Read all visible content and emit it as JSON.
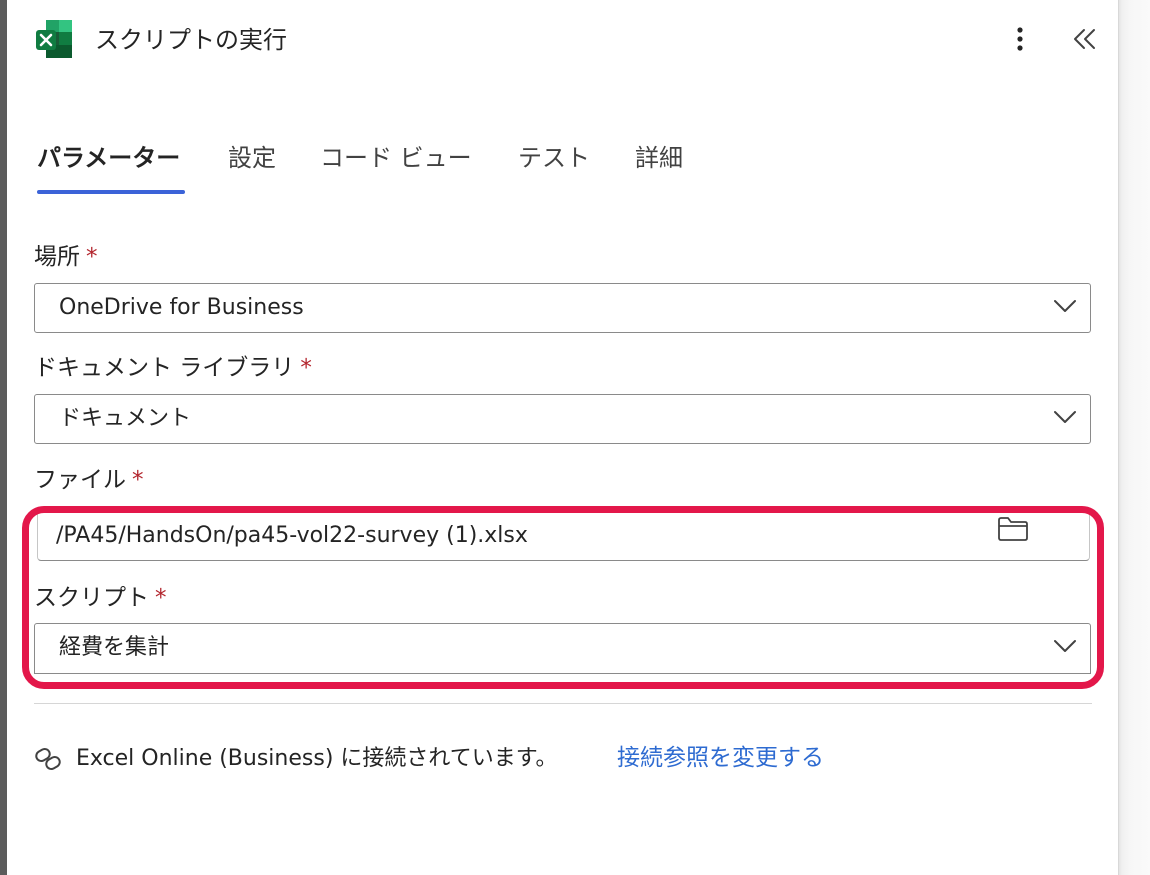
{
  "header": {
    "title": "スクリプトの実行",
    "app_icon": "excel-icon",
    "more_icon": "more-vertical-icon",
    "collapse_icon": "double-chevron-left-icon"
  },
  "tabs": [
    {
      "label": "パラメーター",
      "active": true
    },
    {
      "label": "設定",
      "active": false
    },
    {
      "label": "コード ビュー",
      "active": false
    },
    {
      "label": "テスト",
      "active": false
    },
    {
      "label": "詳細",
      "active": false
    }
  ],
  "fields": {
    "location": {
      "label": "場所",
      "required_mark": "*",
      "value": "OneDrive for Business"
    },
    "library": {
      "label": "ドキュメント ライブラリ",
      "required_mark": "*",
      "value": "ドキュメント"
    },
    "file": {
      "label": "ファイル",
      "required_mark": "*",
      "value": "/PA45/HandsOn/pa45-vol22-survey (1).xlsx",
      "icon": "folder-icon"
    },
    "script": {
      "label": "スクリプト",
      "required_mark": "*",
      "value": "経費を集計"
    }
  },
  "connection": {
    "icon": "link-icon",
    "text": "Excel Online (Business) に接続されています。",
    "change_link": "接続参照を変更する"
  },
  "colors": {
    "accent": "#3b63d8",
    "highlight": "#e3174a",
    "required": "#b3262e",
    "link": "#2e6bd1"
  }
}
